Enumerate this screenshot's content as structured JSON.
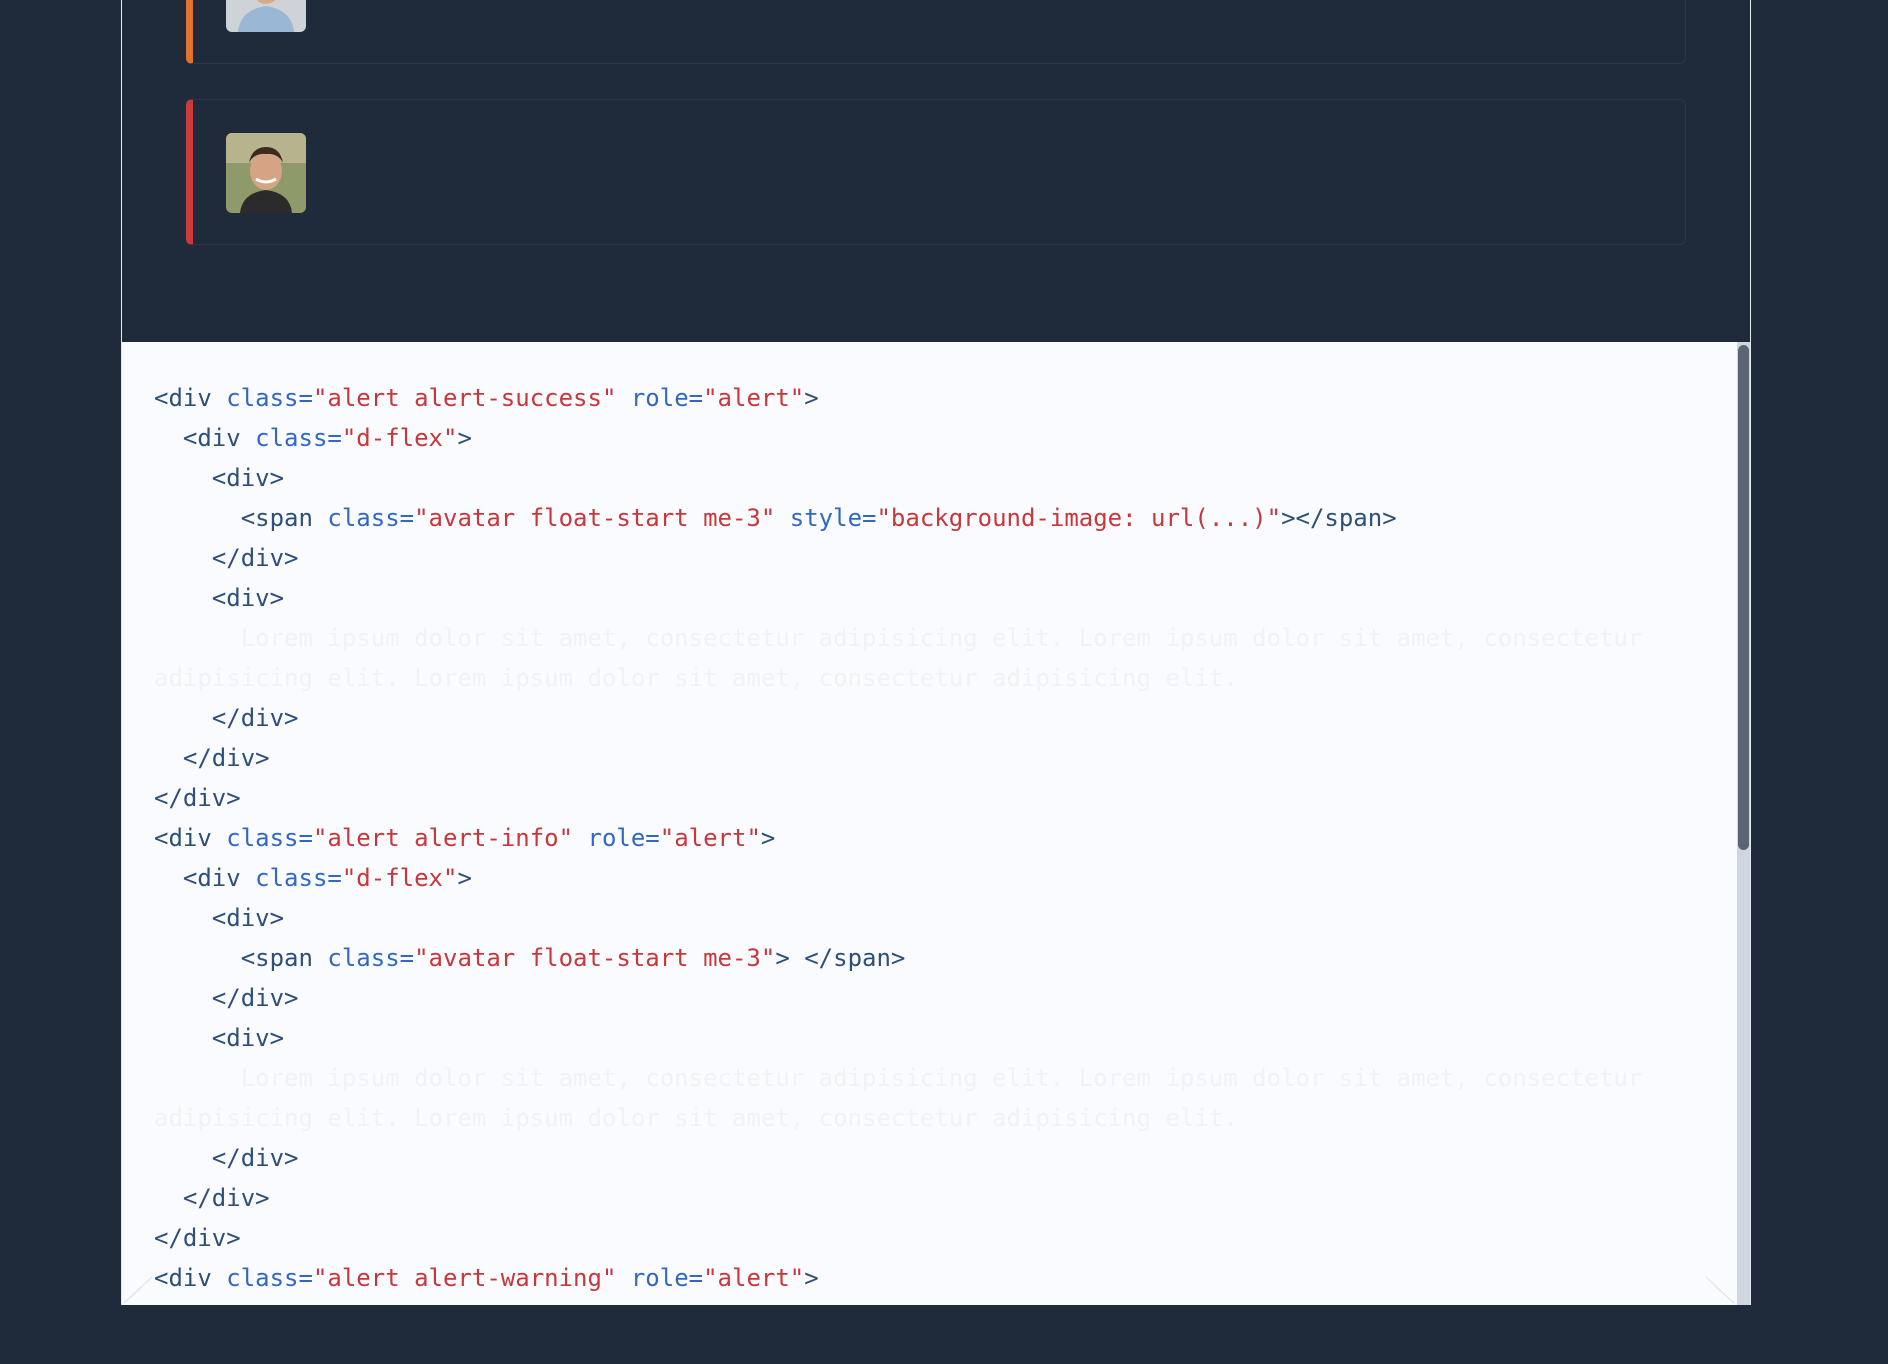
{
  "preview": {
    "alerts": [
      {
        "variant": "warning",
        "accent": "#e2732f",
        "avatar": "user-avatar-photo"
      },
      {
        "variant": "danger",
        "accent": "#cc3b3b",
        "avatar": "user-avatar-photo"
      }
    ]
  },
  "code": {
    "lines": [
      [
        [
          "tag",
          "<div "
        ],
        [
          "attr",
          "class="
        ],
        [
          "str",
          "\"alert alert-success\""
        ],
        [
          "tag",
          " "
        ],
        [
          "attr",
          "role="
        ],
        [
          "str",
          "\"alert\""
        ],
        [
          "tag",
          ">"
        ]
      ],
      [
        [
          "tag",
          "  <div "
        ],
        [
          "attr",
          "class="
        ],
        [
          "str",
          "\"d-flex\""
        ],
        [
          "tag",
          ">"
        ]
      ],
      [
        [
          "tag",
          "    <div>"
        ]
      ],
      [
        [
          "tag",
          "      <span "
        ],
        [
          "attr",
          "class="
        ],
        [
          "str",
          "\"avatar float-start me-3\""
        ],
        [
          "tag",
          " "
        ],
        [
          "attr",
          "style="
        ],
        [
          "str",
          "\"background-image: url(...)\""
        ],
        [
          "tag",
          "></span>"
        ]
      ],
      [
        [
          "tag",
          "    </div>"
        ]
      ],
      [
        [
          "tag",
          "    <div>"
        ]
      ],
      [
        [
          "txt",
          "      Lorem ipsum dolor sit amet, consectetur adipisicing elit. Lorem ipsum dolor sit amet, consectetur"
        ]
      ],
      [
        [
          "txt",
          "adipisicing elit. Lorem ipsum dolor sit amet, consectetur adipisicing elit."
        ]
      ],
      [
        [
          "tag",
          "    </div>"
        ]
      ],
      [
        [
          "tag",
          "  </div>"
        ]
      ],
      [
        [
          "tag",
          "</div>"
        ]
      ],
      [
        [
          "tag",
          "<div "
        ],
        [
          "attr",
          "class="
        ],
        [
          "str",
          "\"alert alert-info\""
        ],
        [
          "tag",
          " "
        ],
        [
          "attr",
          "role="
        ],
        [
          "str",
          "\"alert\""
        ],
        [
          "tag",
          ">"
        ]
      ],
      [
        [
          "tag",
          "  <div "
        ],
        [
          "attr",
          "class="
        ],
        [
          "str",
          "\"d-flex\""
        ],
        [
          "tag",
          ">"
        ]
      ],
      [
        [
          "tag",
          "    <div>"
        ]
      ],
      [
        [
          "tag",
          "      <span "
        ],
        [
          "attr",
          "class="
        ],
        [
          "str",
          "\"avatar float-start me-3\""
        ],
        [
          "tag",
          "> </span>"
        ]
      ],
      [
        [
          "tag",
          "    </div>"
        ]
      ],
      [
        [
          "tag",
          "    <div>"
        ]
      ],
      [
        [
          "txt",
          "      Lorem ipsum dolor sit amet, consectetur adipisicing elit. Lorem ipsum dolor sit amet, consectetur"
        ]
      ],
      [
        [
          "txt",
          "adipisicing elit. Lorem ipsum dolor sit amet, consectetur adipisicing elit."
        ]
      ],
      [
        [
          "tag",
          "    </div>"
        ]
      ],
      [
        [
          "tag",
          "  </div>"
        ]
      ],
      [
        [
          "tag",
          "</div>"
        ]
      ],
      [
        [
          "tag",
          "<div "
        ],
        [
          "attr",
          "class="
        ],
        [
          "str",
          "\"alert alert-warning\""
        ],
        [
          "tag",
          " "
        ],
        [
          "attr",
          "role="
        ],
        [
          "str",
          "\"alert\""
        ],
        [
          "tag",
          ">"
        ]
      ]
    ]
  }
}
